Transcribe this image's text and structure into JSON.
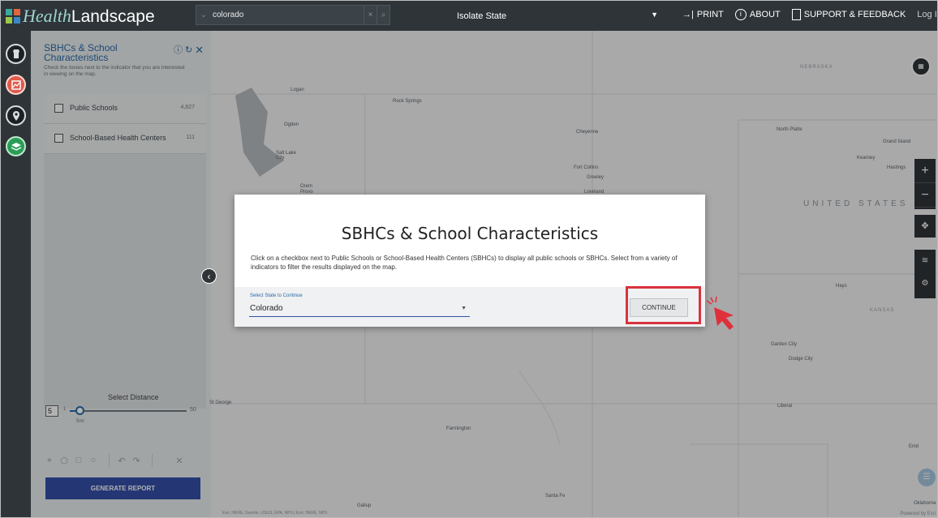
{
  "app": {
    "brand_part1": "Health",
    "brand_part2": "Landscape"
  },
  "topbar": {
    "search_value": "colorado",
    "isolate_label": "Isolate State",
    "print": "PRINT",
    "about": "ABOUT",
    "support": "SUPPORT & FEEDBACK",
    "login": "Log In"
  },
  "panel": {
    "title": "SBHCs & School Characteristics",
    "description": "Check the boxes next to the indicator that you are interested in viewing on the map.",
    "items": [
      {
        "label": "Public Schools",
        "count": "4,827"
      },
      {
        "label": "School-Based Health Centers",
        "count": "111"
      }
    ],
    "distance_title": "Select Distance",
    "distance_value": "5",
    "distance_min": "1",
    "distance_max": "50",
    "distance_caption": "5mi",
    "distance_level": 0.08,
    "generate_button": "GENERATE REPORT"
  },
  "map": {
    "cities": [
      "Logan",
      "Rock Springs",
      "Ogden",
      "Salt Lake City",
      "Orem",
      "Provo",
      "Cheyenne",
      "Fort Collins",
      "Greeley",
      "Loveland",
      "North Platte",
      "Grand Island",
      "Kearney",
      "Hastings",
      "NEBRASKA",
      "UNITED STATES",
      "Hays",
      "KANSAS",
      "Garden City",
      "Dodge City",
      "Liberal",
      "St George",
      "Farmington",
      "Santa Fe",
      "Gallup",
      "Enid",
      "Oklahoma"
    ],
    "attribution": "Esri, HERE, Garmin, USGS, EPA, NPS | Esri, HERE, NPS",
    "powered_by": "Powered by Esri"
  },
  "modal": {
    "title": "SBHCs & School Characteristics",
    "body": "Click on a checkbox next to Public Schools or School-Based Health Centers (SBHCs) to display all public schools or SBHCs. Select from a variety of indicators to filter the results displayed on the map.",
    "select_label": "Select State to Continue",
    "select_value": "Colorado",
    "continue_button": "CONTINUE"
  },
  "colors": {
    "topbar_bg": "#2e3438",
    "accent_blue": "#344ea6",
    "link_blue": "#2a6aa8",
    "highlight_red": "#d9333e"
  }
}
